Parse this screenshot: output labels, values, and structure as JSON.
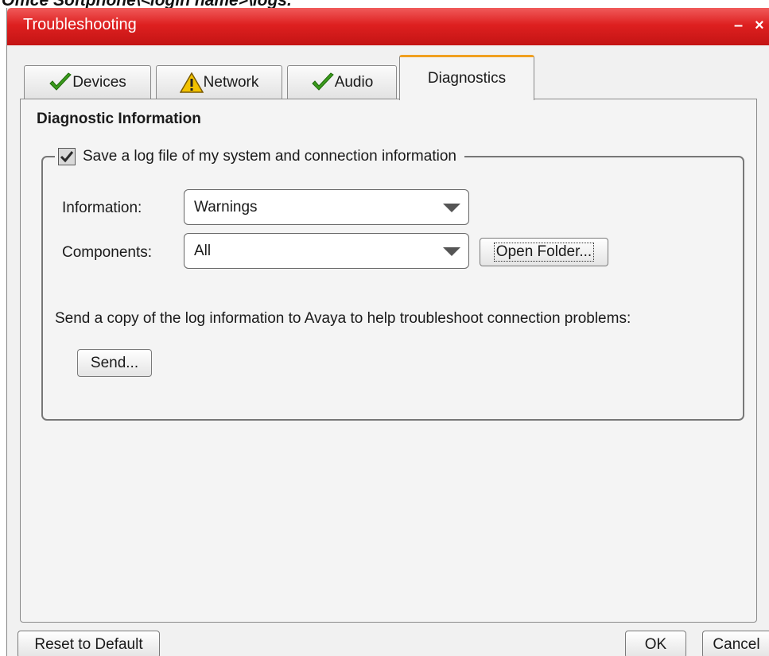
{
  "doc_heading": "Office Softphone\\<login name>\\logs.",
  "window": {
    "title": "Troubleshooting",
    "minimize_label": "–",
    "close_label": "×"
  },
  "tabs": [
    {
      "label": "Devices",
      "icon": "check-icon",
      "active": false
    },
    {
      "label": "Network",
      "icon": "warning-icon",
      "active": false
    },
    {
      "label": "Audio",
      "icon": "check-icon",
      "active": false
    },
    {
      "label": "Diagnostics",
      "icon": "",
      "active": true
    }
  ],
  "diagnostics": {
    "section_title": "Diagnostic Information",
    "save_log": {
      "label": "Save a log file of my system and connection information",
      "checked": true
    },
    "information": {
      "label": "Information:",
      "value": "Warnings"
    },
    "components": {
      "label": "Components:",
      "value": "All"
    },
    "open_folder_label": "Open Folder...",
    "send_text": "Send a copy of the log information to Avaya to help troubleshoot connection problems:",
    "send_label": "Send..."
  },
  "footer": {
    "reset_label": "Reset to Default",
    "ok_label": "OK",
    "cancel_label": "Cancel"
  },
  "colors": {
    "titlebar": "#d91c1c",
    "active_tab_accent": "#f0a020",
    "check_green": "#3a9a1c",
    "warning_yellow": "#f2c200"
  }
}
